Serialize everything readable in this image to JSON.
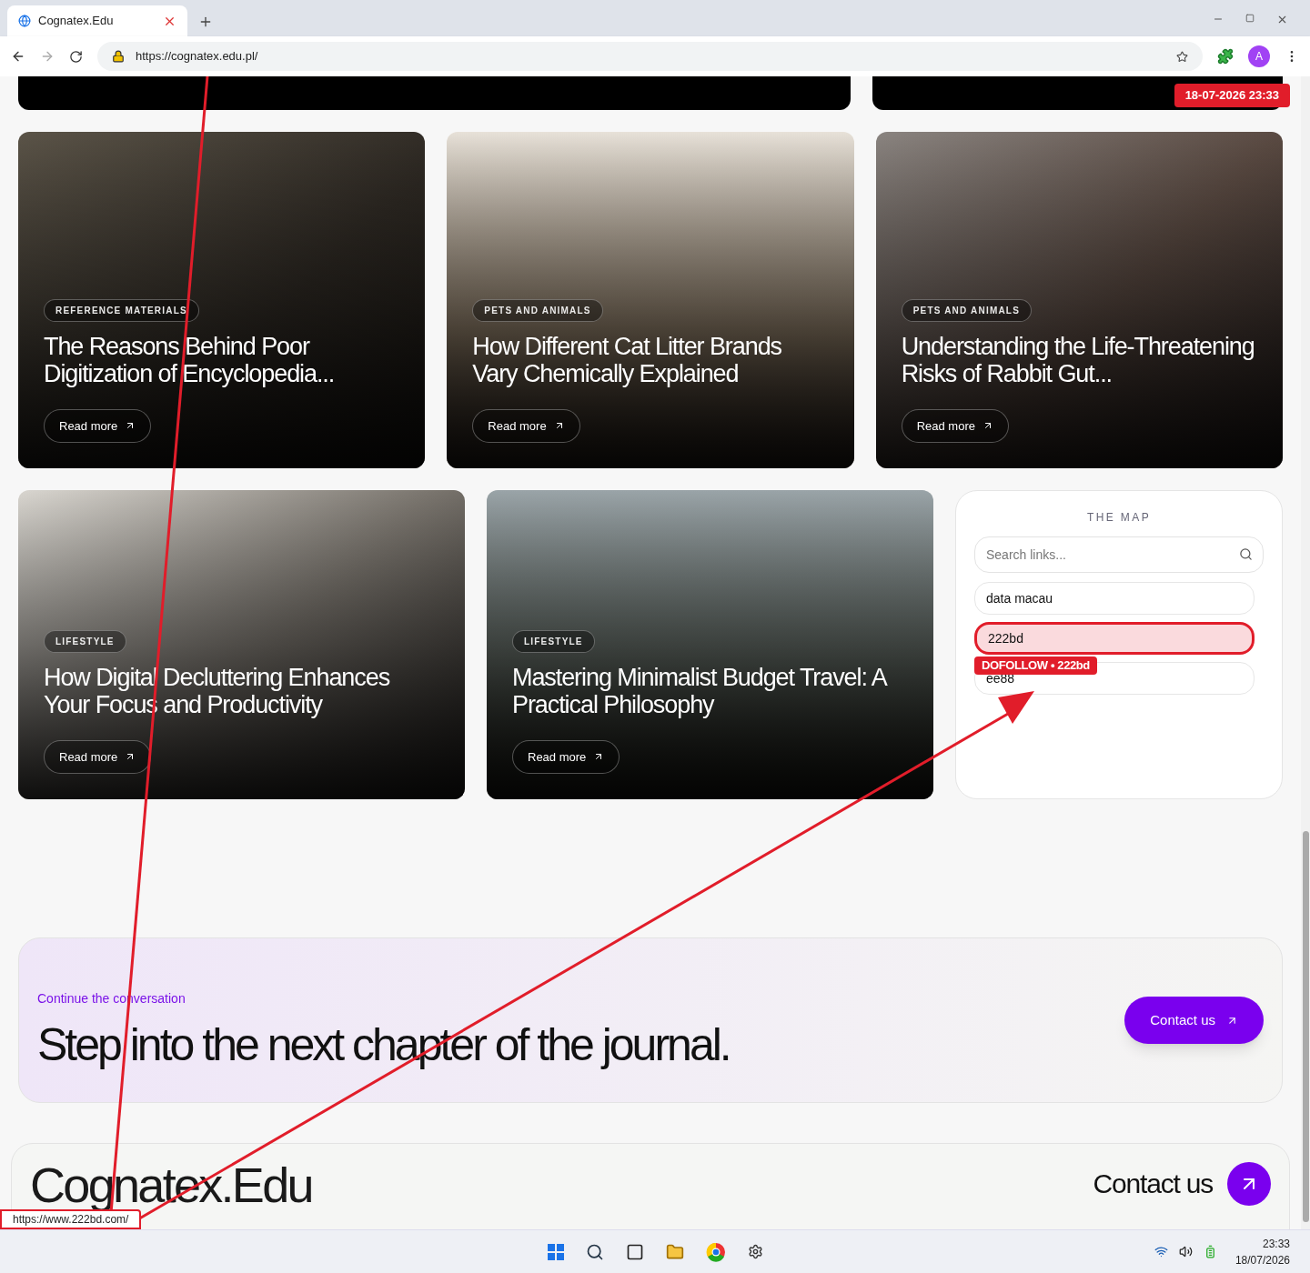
{
  "browser": {
    "tab_title": "Cognatex.Edu",
    "url": "https://cognatex.edu.pl/",
    "profile_initial": "A"
  },
  "timestamp": "18-07-2026 23:33",
  "articles": [
    {
      "category": "REFERENCE MATERIALS",
      "title": "The Reasons Behind Poor Digitization of Encyclopedia...",
      "button": "Read more"
    },
    {
      "category": "PETS AND ANIMALS",
      "title": "How Different Cat Litter Brands Vary Chemically Explained",
      "button": "Read more"
    },
    {
      "category": "PETS AND ANIMALS",
      "title": "Understanding the Life-Threatening Risks of Rabbit Gut...",
      "button": "Read more"
    },
    {
      "category": "LIFESTYLE",
      "title": "How Digital Decluttering Enhances Your Focus and Productivity",
      "button": "Read more"
    },
    {
      "category": "LIFESTYLE",
      "title": "Mastering Minimalist Budget Travel: A Practical Philosophy",
      "button": "Read more"
    }
  ],
  "map": {
    "title": "THE MAP",
    "search": {
      "placeholder": "Search links..."
    },
    "links": [
      {
        "label": "data macau",
        "selected": false
      },
      {
        "label": "222bd",
        "selected": true
      },
      {
        "label": "ee88",
        "selected": false
      }
    ],
    "tooltip": "DOFOLLOW • 222bd"
  },
  "cta": {
    "eyebrow": "Continue the conversation",
    "heading": "Step into the next chapter of the journal.",
    "button": "Contact us"
  },
  "footer": {
    "brand": "Cognatex.Edu",
    "contact": "Contact us"
  },
  "status_url": "https://www.222bd.com/",
  "taskbar": {
    "time": "23:33",
    "date": "18/07/2026"
  }
}
